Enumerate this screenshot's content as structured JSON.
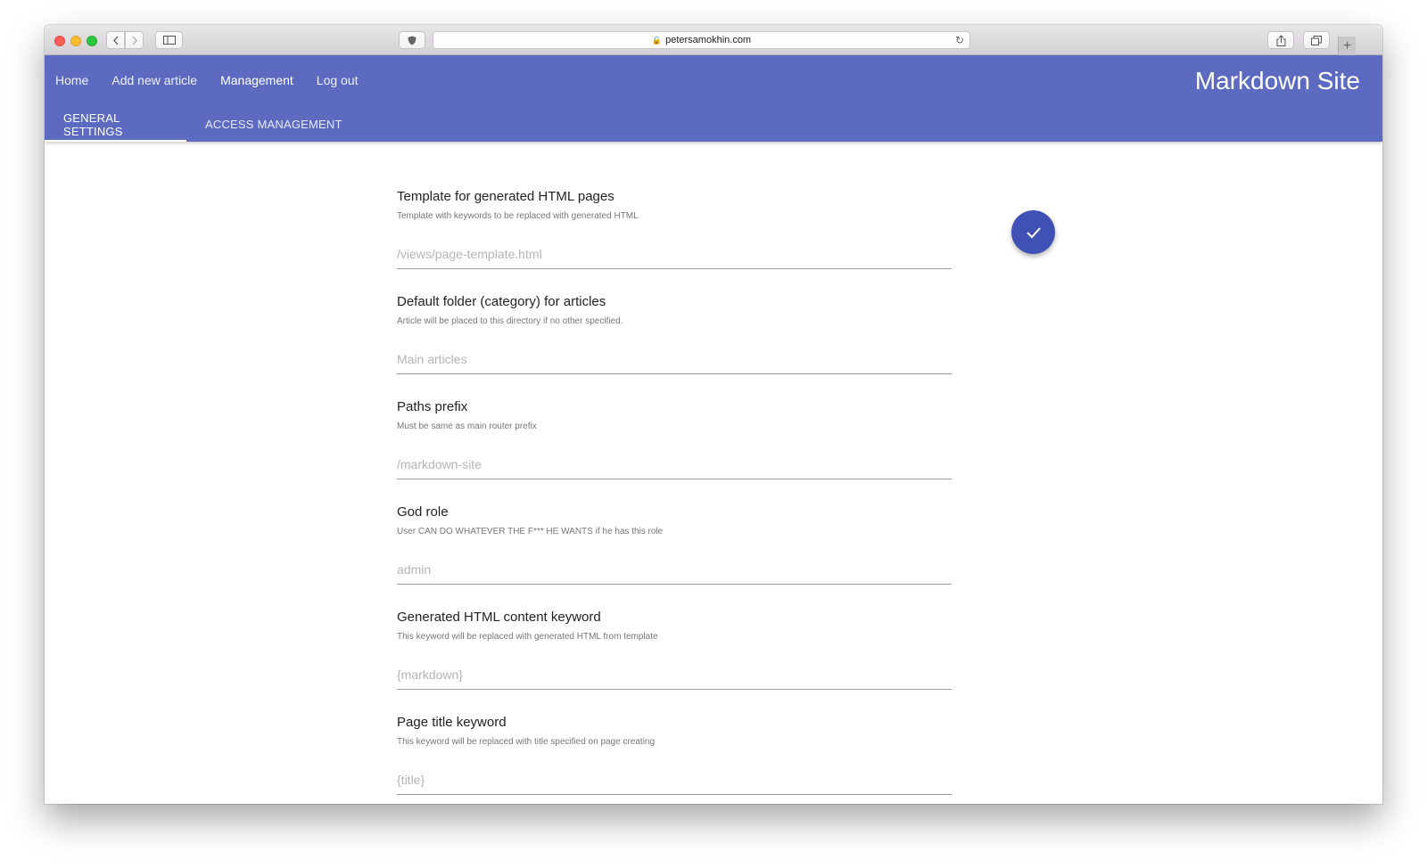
{
  "browser": {
    "url": "petersamokhin.com"
  },
  "nav": {
    "items": [
      "Home",
      "Add new article",
      "Management",
      "Log out"
    ],
    "active": "Management"
  },
  "site_title": "Markdown Site",
  "tabs": [
    {
      "label": "GENERAL SETTINGS",
      "active": true
    },
    {
      "label": "ACCESS MANAGEMENT",
      "active": false
    }
  ],
  "fields": [
    {
      "title": "Template for generated HTML pages",
      "description": "Template with keywords to be replaced with generated HTML",
      "placeholder": "/views/page-template.html"
    },
    {
      "title": "Default folder (category) for articles",
      "description": "Article will be placed to this directory if no other specified.",
      "placeholder": "Main articles"
    },
    {
      "title": "Paths prefix",
      "description": "Must be same as main router prefix",
      "placeholder": "/markdown-site"
    },
    {
      "title": "God role",
      "description": "User CAN DO WHATEVER THE F*** HE WANTS if he has this role",
      "placeholder": "admin"
    },
    {
      "title": "Generated HTML content keyword",
      "description": "This keyword will be replaced with generated HTML from template",
      "placeholder": "{markdown}"
    },
    {
      "title": "Page title keyword",
      "description": "This keyword will be replaced with title specified on page creating",
      "placeholder": "{title}"
    }
  ],
  "colors": {
    "appbar": "#5c6bc0",
    "fab": "#3f51b5"
  },
  "icons": {
    "fab": "check-icon"
  }
}
